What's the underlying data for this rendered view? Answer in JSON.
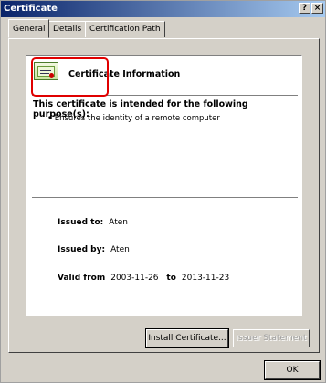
{
  "window": {
    "title": "Certificate",
    "help_glyph": "?",
    "close_glyph": "×"
  },
  "tabs": [
    {
      "label": "General",
      "active": true
    },
    {
      "label": "Details",
      "active": false
    },
    {
      "label": "Certification Path",
      "active": false
    }
  ],
  "general": {
    "icon": "certificate-icon",
    "info_title": "Certificate Information",
    "purpose_heading": "This certificate is intended for the following purpose(s):",
    "purposes": [
      "• Ensures the identity of a remote computer"
    ],
    "issued_to_label": "Issued to:",
    "issued_to_value": "Aten",
    "issued_by_label": "Issued by:",
    "issued_by_value": "Aten",
    "valid_from_label": "Valid from",
    "valid_from_value": "2003-11-26",
    "valid_to_label": "to",
    "valid_to_value": "2013-11-23"
  },
  "buttons": {
    "install": "Install Certificate...",
    "issuer": "Issuer Statement",
    "ok": "OK"
  },
  "colors": {
    "highlight": "#e00000",
    "titlebar_start": "#0a246a",
    "titlebar_end": "#a6caf0"
  }
}
